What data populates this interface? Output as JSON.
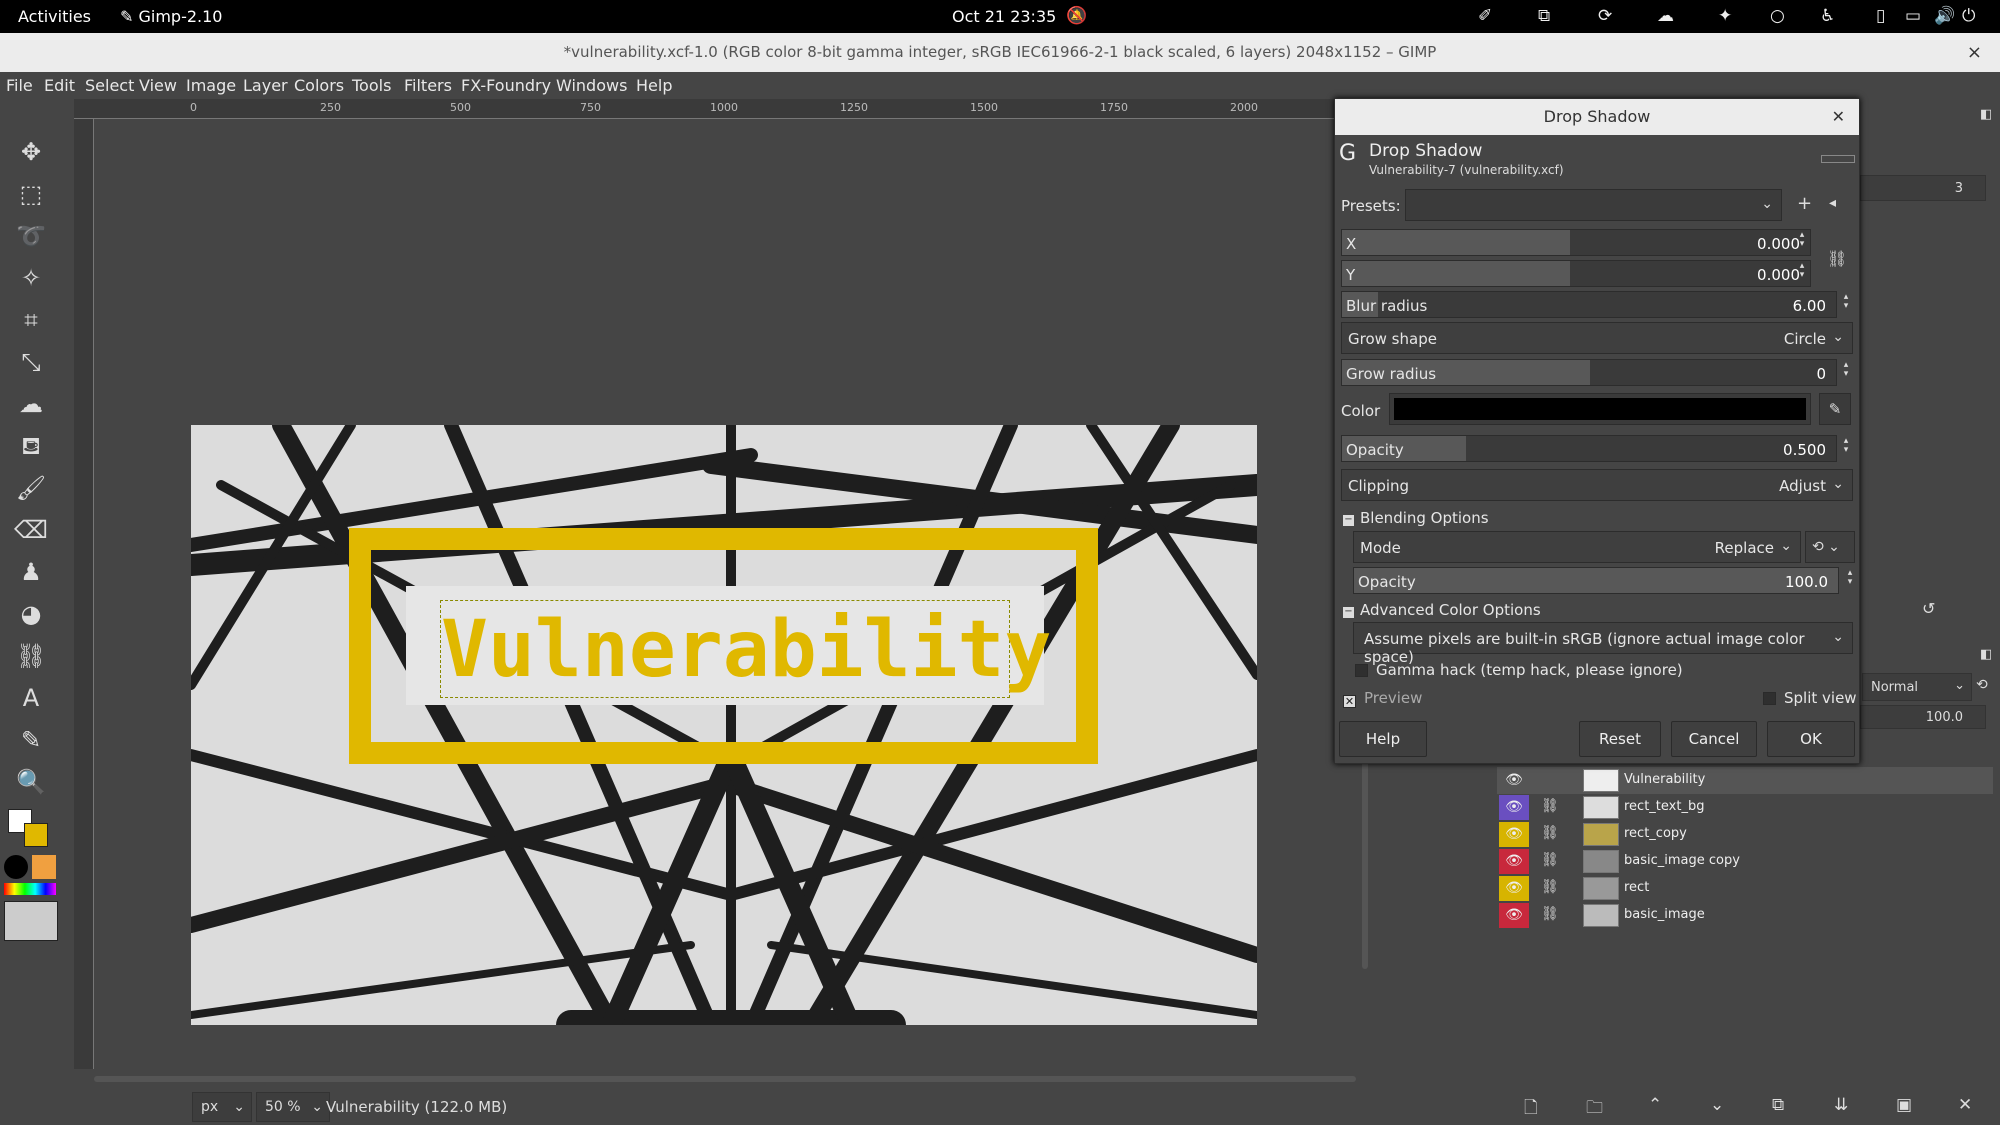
{
  "topbar": {
    "activities": "Activities",
    "app_name": "Gimp-2.10",
    "datetime": "Oct 21  23:35"
  },
  "window": {
    "title": "*vulnerability.xcf-1.0 (RGB color 8-bit gamma integer, sRGB IEC61966-2-1 black scaled, 6 layers) 2048x1152 – GIMP",
    "close": "×"
  },
  "menu": [
    "File",
    "Edit",
    "Select",
    "View",
    "Image",
    "Layer",
    "Colors",
    "Tools",
    "Filters",
    "FX-Foundry",
    "Windows",
    "Help"
  ],
  "ruler": {
    "top_ticks": [
      "0",
      "250",
      "500",
      "750",
      "1000",
      "1250",
      "1500",
      "1750",
      "2000"
    ]
  },
  "canvas": {
    "text": "Vulnerability",
    "colors": {
      "accent_yellow": "#e0b800",
      "background": "#454545"
    }
  },
  "status": {
    "unit": "px",
    "zoom": "50 %",
    "info": "Vulnerability (122.0 MB)"
  },
  "dialog": {
    "window_title": "Drop Shadow",
    "filter_name": "Drop Shadow",
    "subtitle": "Vulnerability-7 (vulnerability.xcf)",
    "presets_label": "Presets:",
    "x": {
      "label": "X",
      "value": "0.000"
    },
    "y": {
      "label": "Y",
      "value": "0.000"
    },
    "blur": {
      "label": "Blur radius",
      "value": "6.00"
    },
    "grow_shape": {
      "label": "Grow shape",
      "value": "Circle"
    },
    "grow_radius": {
      "label": "Grow radius",
      "value": "0"
    },
    "color_label": "Color",
    "opacity": {
      "label": "Opacity",
      "value": "0.500"
    },
    "clipping": {
      "label": "Clipping",
      "value": "Adjust"
    },
    "blending_options": "Blending Options",
    "mode": {
      "label": "Mode",
      "value": "Replace"
    },
    "blend_opacity": {
      "label": "Opacity",
      "value": "100.0"
    },
    "advanced_color": "Advanced Color Options",
    "color_space": "Assume pixels are built-in sRGB (ignore actual image color space)",
    "gamma_hack": "Gamma hack (temp hack, please ignore)",
    "preview": "Preview",
    "split_view": "Split view",
    "buttons": {
      "help": "Help",
      "reset": "Reset",
      "cancel": "Cancel",
      "ok": "OK"
    }
  },
  "right_dock": {
    "spin_value": "3",
    "layer_mode": "Normal",
    "layer_opacity": "100.0"
  },
  "layers": [
    {
      "name": "Vulnerability",
      "eye_color": "#454545"
    },
    {
      "name": "rect_text_bg",
      "eye_color": "#6a4fc0"
    },
    {
      "name": "rect_copy",
      "eye_color": "#d7b400"
    },
    {
      "name": "basic_image copy",
      "eye_color": "#c8283c"
    },
    {
      "name": "rect",
      "eye_color": "#d7b400"
    },
    {
      "name": "basic_image",
      "eye_color": "#c8283c"
    }
  ]
}
